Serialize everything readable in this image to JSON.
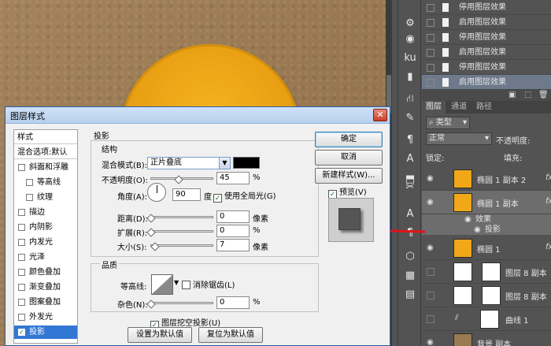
{
  "dialog": {
    "title": "图层样式",
    "close_glyph": "✕",
    "style_list": [
      {
        "label": "样式",
        "checkbox": false,
        "checked": false,
        "selected": false
      },
      {
        "label": "混合选项:默认",
        "checkbox": false,
        "checked": false,
        "selected": false
      },
      {
        "label": "斜面和浮雕",
        "checkbox": true,
        "checked": false,
        "selected": false
      },
      {
        "label": "等高线",
        "checkbox": true,
        "checked": false,
        "selected": false,
        "indent": true
      },
      {
        "label": "纹理",
        "checkbox": true,
        "checked": false,
        "selected": false,
        "indent": true
      },
      {
        "label": "描边",
        "checkbox": true,
        "checked": false,
        "selected": false
      },
      {
        "label": "内阴影",
        "checkbox": true,
        "checked": false,
        "selected": false
      },
      {
        "label": "内发光",
        "checkbox": true,
        "checked": false,
        "selected": false
      },
      {
        "label": "光泽",
        "checkbox": true,
        "checked": false,
        "selected": false
      },
      {
        "label": "颜色叠加",
        "checkbox": true,
        "checked": false,
        "selected": false
      },
      {
        "label": "渐变叠加",
        "checkbox": true,
        "checked": false,
        "selected": false
      },
      {
        "label": "图案叠加",
        "checkbox": true,
        "checked": false,
        "selected": false
      },
      {
        "label": "外发光",
        "checkbox": true,
        "checked": false,
        "selected": false
      },
      {
        "label": "投影",
        "checkbox": true,
        "checked": true,
        "selected": true
      }
    ],
    "section_title": "投影",
    "structure_title": "结构",
    "blend_mode_label": "混合模式(B):",
    "blend_mode_value": "正片叠底",
    "opacity_label": "不透明度(O):",
    "opacity_value": "45",
    "opacity_unit": "%",
    "angle_label": "角度(A):",
    "angle_value": "90",
    "angle_unit": "度",
    "global_light_label": "使用全局光(G)",
    "global_light_checked": true,
    "distance_label": "距离(D):",
    "distance_value": "0",
    "distance_unit": "像素",
    "spread_label": "扩展(R):",
    "spread_value": "0",
    "spread_unit": "%",
    "size_label": "大小(S):",
    "size_value": "7",
    "size_unit": "像素",
    "quality_title": "品质",
    "contour_label": "等高线:",
    "antialias_label": "消除锯齿(L)",
    "antialias_checked": false,
    "noise_label": "杂色(N):",
    "noise_value": "0",
    "noise_unit": "%",
    "knockout_label": "图层挖空投影(U)",
    "knockout_checked": true,
    "set_default_label": "设置为默认值",
    "reset_default_label": "复位为默认值",
    "ok_label": "确定",
    "cancel_label": "取消",
    "new_style_label": "新建样式(W)...",
    "preview_label": "预览(V)",
    "preview_checked": true,
    "shadow_color": "#000000"
  },
  "history": {
    "items": [
      {
        "label": "停用图层效果",
        "selected": false
      },
      {
        "label": "启用图层效果",
        "selected": false
      },
      {
        "label": "停用图层效果",
        "selected": false
      },
      {
        "label": "启用图层效果",
        "selected": false
      },
      {
        "label": "停用图层效果",
        "selected": false
      },
      {
        "label": "启用图层效果",
        "selected": true
      }
    ]
  },
  "layers": {
    "tabs": [
      "图层",
      "通道",
      "路径"
    ],
    "filter_label": "类型",
    "blend_mode": "正常",
    "opacity_label": "不透明度:",
    "lock_label": "锁定:",
    "fill_label": "填充:",
    "items": [
      {
        "name": "椭圆 1 副本 2",
        "thumb": "orange",
        "fx": "fx",
        "selected": false
      },
      {
        "name": "椭圆 1 副本",
        "thumb": "orange",
        "fx": "fx",
        "selected": true
      },
      {
        "name": "椭圆 1",
        "thumb": "orange",
        "fx": "fx",
        "selected": false
      },
      {
        "name": "图层 8 副本",
        "thumb": "checker",
        "mask": true,
        "fx": "",
        "selected": false
      },
      {
        "name": "图层 8 副本",
        "thumb": "checker",
        "mask": true,
        "fx": "",
        "selected": false
      },
      {
        "name": "曲线 1",
        "thumb": "curves",
        "fx": "",
        "selected": false
      },
      {
        "name": "背景 副本",
        "thumb": "brown",
        "fx": "",
        "selected": false
      }
    ],
    "effects_label": "效果",
    "drop_shadow_label": "投影"
  },
  "tools": [
    "⚙",
    "◉",
    "ku",
    "▮",
    "⛙",
    "✎",
    "¶",
    "A",
    "⬒",
    "✂",
    "A",
    "¶",
    "⬡",
    "▦",
    "▤"
  ],
  "colors": {
    "accent_blue": "#3377d4",
    "red_arrow": "#e0141a",
    "orange": "#f0a818"
  }
}
